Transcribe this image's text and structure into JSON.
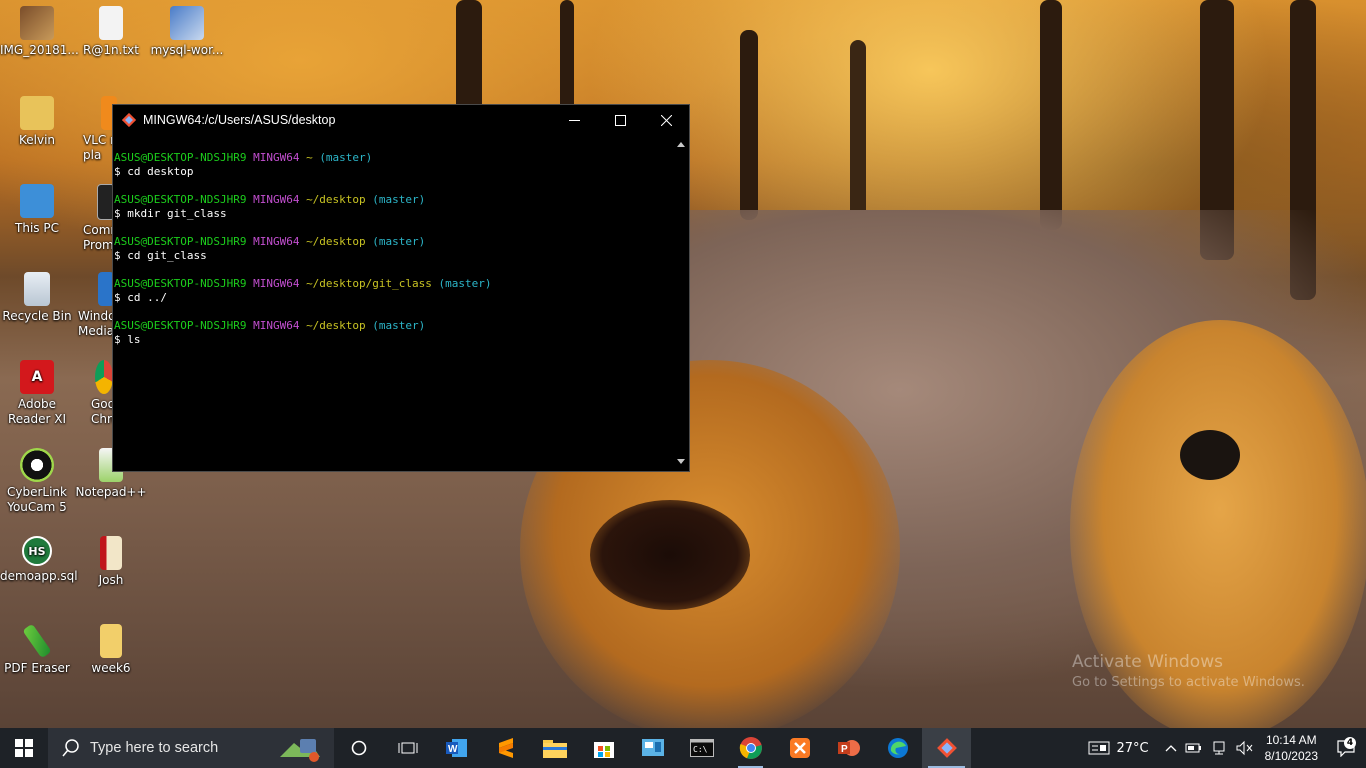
{
  "desktop": {
    "icons": [
      {
        "label": "IMG_20181...",
        "icon": "photo-icon"
      },
      {
        "label": "R@1n.txt",
        "icon": "text-file-icon"
      },
      {
        "label": "mysql-wor...",
        "icon": "installer-icon"
      },
      {
        "label": "Kelvin",
        "icon": "user-folder-icon"
      },
      {
        "label": "VLC r\npla",
        "icon": "vlc-icon"
      },
      {
        "label": "This PC",
        "icon": "computer-icon"
      },
      {
        "label": "Comm\nProm",
        "icon": "command-prompt-icon"
      },
      {
        "label": "Recycle Bin",
        "icon": "recycle-bin-icon"
      },
      {
        "label": "Windo\nMedia",
        "icon": "media-player-icon"
      },
      {
        "label": "Adobe\nReader XI",
        "icon": "adobe-reader-icon"
      },
      {
        "label": "Goo\nChro",
        "icon": "chrome-icon"
      },
      {
        "label": "CyberLink\nYouCam 5",
        "icon": "youcam-icon"
      },
      {
        "label": "Notepad++",
        "icon": "notepadpp-icon"
      },
      {
        "label": "demoapp.sql",
        "icon": "sql-file-icon"
      },
      {
        "label": "Josh",
        "icon": "document-icon"
      },
      {
        "label": "PDF Eraser",
        "icon": "pdf-eraser-icon"
      },
      {
        "label": "week6",
        "icon": "folder-icon"
      }
    ],
    "watermark": {
      "line1": "Activate Windows",
      "line2": "Go to Settings to activate Windows."
    }
  },
  "terminal": {
    "title": "MINGW64:/c/Users/ASUS/desktop",
    "prompts": [
      {
        "user": "ASUS@DESKTOP-NDSJHR9",
        "env": "MINGW64",
        "path": "~",
        "branch": "(master)",
        "command": "$ cd desktop"
      },
      {
        "user": "ASUS@DESKTOP-NDSJHR9",
        "env": "MINGW64",
        "path": "~/desktop",
        "branch": "(master)",
        "command": "$ mkdir git_class"
      },
      {
        "user": "ASUS@DESKTOP-NDSJHR9",
        "env": "MINGW64",
        "path": "~/desktop",
        "branch": "(master)",
        "command": "$ cd git_class"
      },
      {
        "user": "ASUS@DESKTOP-NDSJHR9",
        "env": "MINGW64",
        "path": "~/desktop/git_class",
        "branch": "(master)",
        "command": "$ cd ../"
      },
      {
        "user": "ASUS@DESKTOP-NDSJHR9",
        "env": "MINGW64",
        "path": "~/desktop",
        "branch": "(master)",
        "command": "$ ls"
      }
    ]
  },
  "taskbar": {
    "search_placeholder": "Type here to search",
    "apps": [
      {
        "name": "cortana-icon"
      },
      {
        "name": "task-view-icon"
      },
      {
        "name": "word-icon"
      },
      {
        "name": "sublime-text-icon"
      },
      {
        "name": "file-explorer-icon"
      },
      {
        "name": "microsoft-store-icon"
      },
      {
        "name": "control-panel-icon"
      },
      {
        "name": "terminal-icon"
      },
      {
        "name": "chrome-icon"
      },
      {
        "name": "xampp-icon"
      },
      {
        "name": "powerpoint-icon"
      },
      {
        "name": "edge-icon"
      },
      {
        "name": "git-bash-icon"
      }
    ],
    "weather": "27°C",
    "time": "10:14 AM",
    "date": "8/10/2023",
    "notification_count": "4"
  },
  "colors": {
    "prompt_user": "#1ccd1c",
    "prompt_env": "#c34fd0",
    "prompt_path": "#c8c323",
    "prompt_branch": "#2cb5c8",
    "taskbar_bg": "#1e2227"
  }
}
